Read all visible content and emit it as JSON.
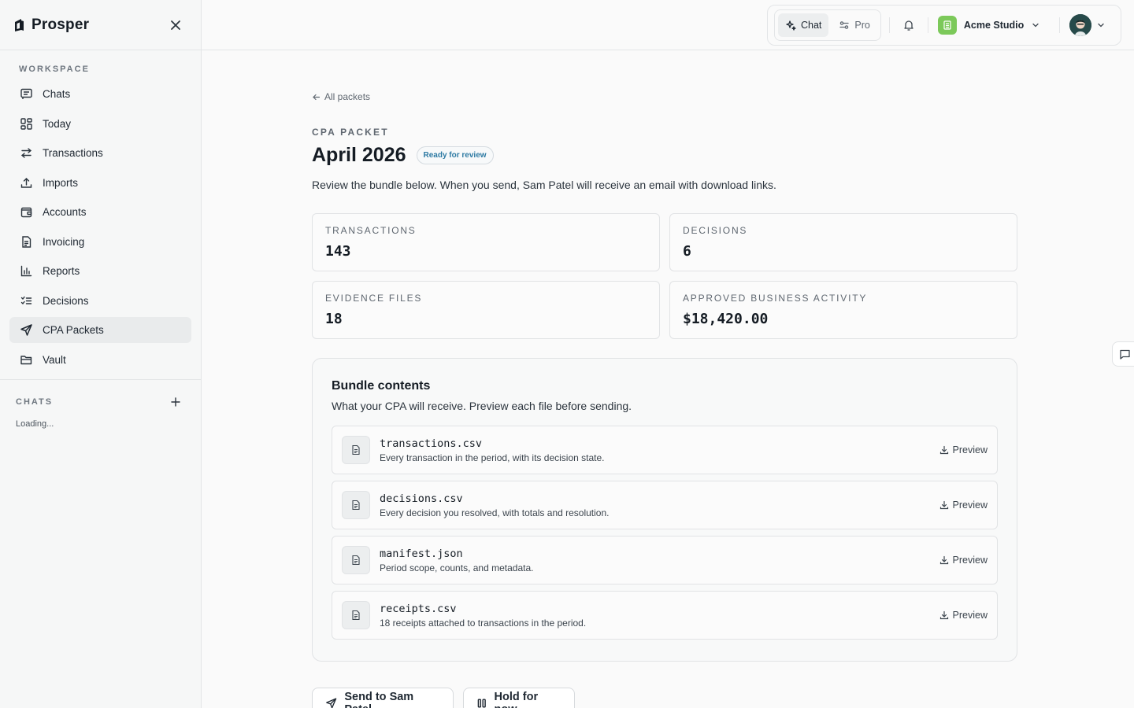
{
  "app": {
    "name": "Prosper"
  },
  "sidebar": {
    "workspace_label": "WORKSPACE",
    "items": [
      {
        "label": "Chats",
        "icon": "chat-icon",
        "active": false
      },
      {
        "label": "Today",
        "icon": "grid-icon",
        "active": false
      },
      {
        "label": "Transactions",
        "icon": "arrows-icon",
        "active": false
      },
      {
        "label": "Imports",
        "icon": "upload-icon",
        "active": false
      },
      {
        "label": "Accounts",
        "icon": "wallet-icon",
        "active": false
      },
      {
        "label": "Invoicing",
        "icon": "document-icon",
        "active": false
      },
      {
        "label": "Reports",
        "icon": "bar-chart-icon",
        "active": false
      },
      {
        "label": "Decisions",
        "icon": "checklist-icon",
        "active": false
      },
      {
        "label": "CPA Packets",
        "icon": "send-icon",
        "active": true
      },
      {
        "label": "Vault",
        "icon": "folder-icon",
        "active": false
      }
    ],
    "chats_label": "CHATS",
    "chats_status": "Loading..."
  },
  "topbar": {
    "modes": [
      {
        "label": "Chat",
        "icon": "sparkle-icon",
        "active": true
      },
      {
        "label": "Pro",
        "icon": "sliders-icon",
        "active": false
      }
    ],
    "org_name": "Acme Studio"
  },
  "packet": {
    "back_label": "All packets",
    "eyebrow": "CPA PACKET",
    "title": "April 2026",
    "status_badge": "Ready for review",
    "description": "Review the bundle below. When you send, Sam Patel will receive an email with download links."
  },
  "stats": [
    {
      "label": "TRANSACTIONS",
      "value": "143"
    },
    {
      "label": "DECISIONS",
      "value": "6"
    },
    {
      "label": "EVIDENCE FILES",
      "value": "18"
    },
    {
      "label": "APPROVED BUSINESS ACTIVITY",
      "value": "$18,420.00"
    }
  ],
  "bundle": {
    "title": "Bundle contents",
    "subtitle": "What your CPA will receive. Preview each file before sending.",
    "preview_label": "Preview",
    "files": [
      {
        "name": "transactions.csv",
        "description": "Every transaction in the period, with its decision state."
      },
      {
        "name": "decisions.csv",
        "description": "Every decision you resolved, with totals and resolution."
      },
      {
        "name": "manifest.json",
        "description": "Period scope, counts, and metadata."
      },
      {
        "name": "receipts.csv",
        "description": "18 receipts attached to transactions in the period."
      }
    ]
  },
  "actions": {
    "send_label": "Send to Sam Patel",
    "hold_label": "Hold for now"
  },
  "colors": {
    "accent_badge": "#2d7aa3",
    "org_avatar": "#7cc95a",
    "active_nav": "#e9ebec"
  }
}
